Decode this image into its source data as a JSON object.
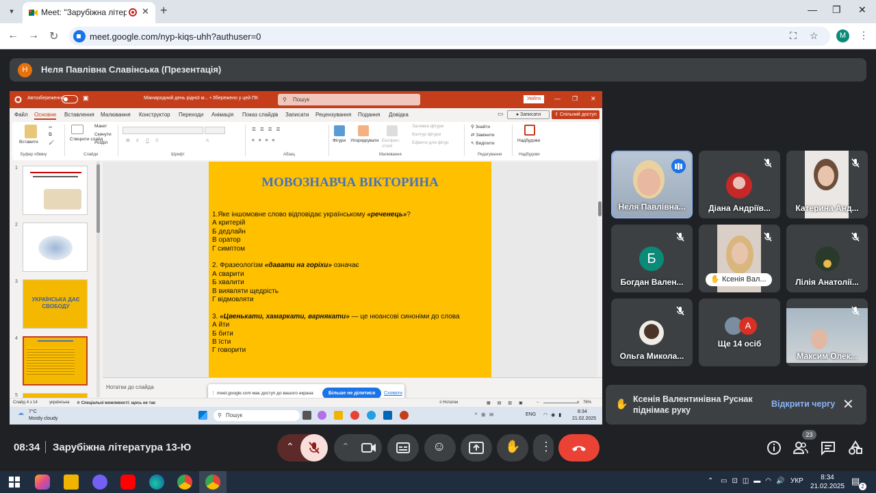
{
  "browser": {
    "tab_title": "Meet: \"Зарубіжна літерату",
    "url": "meet.google.com/nyp-kiqs-uhh?authuser=0",
    "profile_initial": "M"
  },
  "meet": {
    "presenter_initial": "Н",
    "presenter_label": "Неля Павлівна Славінська (Презентація)",
    "time": "08:34",
    "meeting_title": "Зарубіжна література 13-Ю",
    "people_count": "23",
    "raise_hand_text": "Ксенія Валентинівна Руснак піднімає руку",
    "raise_hand_action": "Відкрити чергу",
    "participants": [
      {
        "name": "Неля Павлівна...",
        "state": "speaking"
      },
      {
        "name": "Діана Андріїв...",
        "state": "muted"
      },
      {
        "name": "Катерина Анд...",
        "state": "muted"
      },
      {
        "name": "Богдан Вален...",
        "state": "muted",
        "initial": "Б",
        "color": "#0b8a78"
      },
      {
        "name": "Ксенія Вал...",
        "state": "hand"
      },
      {
        "name": "Лілія Анатолії...",
        "state": "muted"
      },
      {
        "name": "Ольга Микола...",
        "state": "muted"
      },
      {
        "name": "Ще 14 осіб",
        "state": "more",
        "initial": "А"
      },
      {
        "name": "Максим Олек...",
        "state": "muted"
      }
    ]
  },
  "powerpoint": {
    "autosave": "Автозбереження",
    "doc_title": "Міжнародний день рідної м... • Збережено у цей ПК",
    "search": "Пошук",
    "signin": "Увійти",
    "menus": [
      "Файл",
      "Основне",
      "Вставлення",
      "Малювання",
      "Конструктор",
      "Переходи",
      "Анімація",
      "Показ слайдів",
      "Записати",
      "Рецензування",
      "Подання",
      "Довідка"
    ],
    "record_btn": "Записати",
    "share_btn": "Спільний доступ",
    "ribbon": {
      "paste": "Вставити",
      "clipboard": "Буфер обміну",
      "create_slide": "Створити слайд",
      "layout": "Макет",
      "reset": "Скинути",
      "section": "Розділ",
      "slides": "Слайди",
      "font": "Шрифт",
      "paragraph": "Абзац",
      "shapes": "Фігури",
      "arrange": "Упорядкувати",
      "quick_styles": "Експрес-стилі",
      "shape_fill": "Заливка фігури",
      "shape_outline": "Контур фігури",
      "shape_effects": "Ефекти для фігур",
      "drawing": "Малювання",
      "find": "Знайти",
      "replace": "Замінити",
      "select": "Виділити",
      "editing": "Редагування",
      "designer": "Надбудови",
      "addins": "Надбудови"
    },
    "slide": {
      "title": "МОВОЗНАВЧА ВІКТОРИНА",
      "q1_pre": "1.Яке іншомовне слово відповідає українському ",
      "q1_em": "«реченець»",
      "q1_post": "?",
      "q1_a": [
        "А критерій",
        "Б дедлайн",
        "В оратор",
        "Г симптом"
      ],
      "q2_pre": "2. Фразеологізм ",
      "q2_em": "«давати на горіхи»",
      "q2_post": " означає",
      "q2_a": [
        "А сварити",
        "Б хвалити",
        "В виявляти щедрість",
        "Г відмовляти"
      ],
      "q3_pre": "3. ",
      "q3_em": "«Цвенькати, хамаркати, варнякати»",
      "q3_post": " — це нюансові синоніми до слова",
      "q3_a": [
        "А йти",
        "Б бити",
        "В їсти",
        "Г говорити"
      ]
    },
    "notes": "Нотатки до слайда",
    "share_msg": "meet.google.com має доступ до вашого екрана",
    "share_stop": "Більше не ділитися",
    "share_hide": "Сховати",
    "thumb_nums": [
      "1",
      "2",
      "3",
      "4",
      "5"
    ],
    "thumb3_title": "УКРАЇНСЬКА ДАЄ СВОБОДУ",
    "status_slide": "Слайд 4 з 14",
    "status_lang": "українська",
    "status_access": "Спеціальні можливості: щось не так",
    "status_notes": "Нотатки",
    "status_zoom": "76%",
    "inner_weather_temp": "7°C",
    "inner_weather_desc": "Mostly cloudy",
    "inner_search": "Пошук",
    "inner_lang": "ENG",
    "inner_time": "8:34",
    "inner_date": "21.02.2025"
  },
  "taskbar": {
    "lang": "УКР",
    "time": "8:34",
    "date": "21.02.2025",
    "notif_count": "2"
  }
}
